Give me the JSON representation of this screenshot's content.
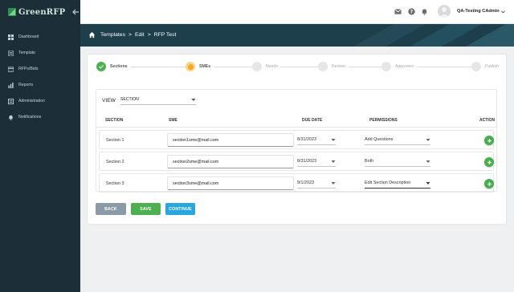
{
  "app": {
    "logo_text": "GreenRFP"
  },
  "sidebar": {
    "items": [
      {
        "label": "Dashboard",
        "icon": "dashboard-icon"
      },
      {
        "label": "Template",
        "icon": "template-icon"
      },
      {
        "label": "RFPs/Bids",
        "icon": "rfps-icon"
      },
      {
        "label": "Reports",
        "icon": "reports-icon"
      },
      {
        "label": "Administration",
        "icon": "administration-icon"
      },
      {
        "label": "Notifications",
        "icon": "bell-icon"
      }
    ]
  },
  "topbar": {
    "user_name": "QA-Testing CAdmin"
  },
  "breadcrumb": {
    "templates": "Templates",
    "edit": "Edit",
    "current": "RFP Test",
    "separator": ">"
  },
  "stepper": {
    "steps": [
      {
        "label": "Sections",
        "state": "done"
      },
      {
        "label": "SMEs",
        "state": "active"
      },
      {
        "label": "Needs",
        "state": "pending"
      },
      {
        "label": "Review",
        "state": "pending"
      },
      {
        "label": "Approvers",
        "state": "pending"
      },
      {
        "label": "Publish",
        "state": "pending"
      }
    ]
  },
  "view": {
    "label": "VIEW",
    "value": "SECTION"
  },
  "table": {
    "headers": {
      "section": "SECTION",
      "sme": "SME",
      "due_date": "DUE DATE",
      "permissions": "PERMISSIONS",
      "action": "ACTION"
    },
    "rows": [
      {
        "section": "Section 1",
        "sme": "section1sme@mail.com",
        "due_date": "8/31/2023",
        "permission": "Add Questions"
      },
      {
        "section": "Section 2",
        "sme": "section2sme@mail.com",
        "due_date": "8/31/2023",
        "permission": "Both"
      },
      {
        "section": "Section 3",
        "sme": "section3sme@mail.com",
        "due_date": "9/1/2023",
        "permission": "Edit Section Description"
      }
    ]
  },
  "buttons": {
    "back": "BACK",
    "save": "SAVE",
    "continue": "CONTINUE"
  },
  "colors": {
    "sidebar": "#1c2f38",
    "banner": "#1d3e4b",
    "success": "#4caf50",
    "active_step": "#f5a623",
    "continue": "#29a6df",
    "back": "#8a9aa6"
  }
}
